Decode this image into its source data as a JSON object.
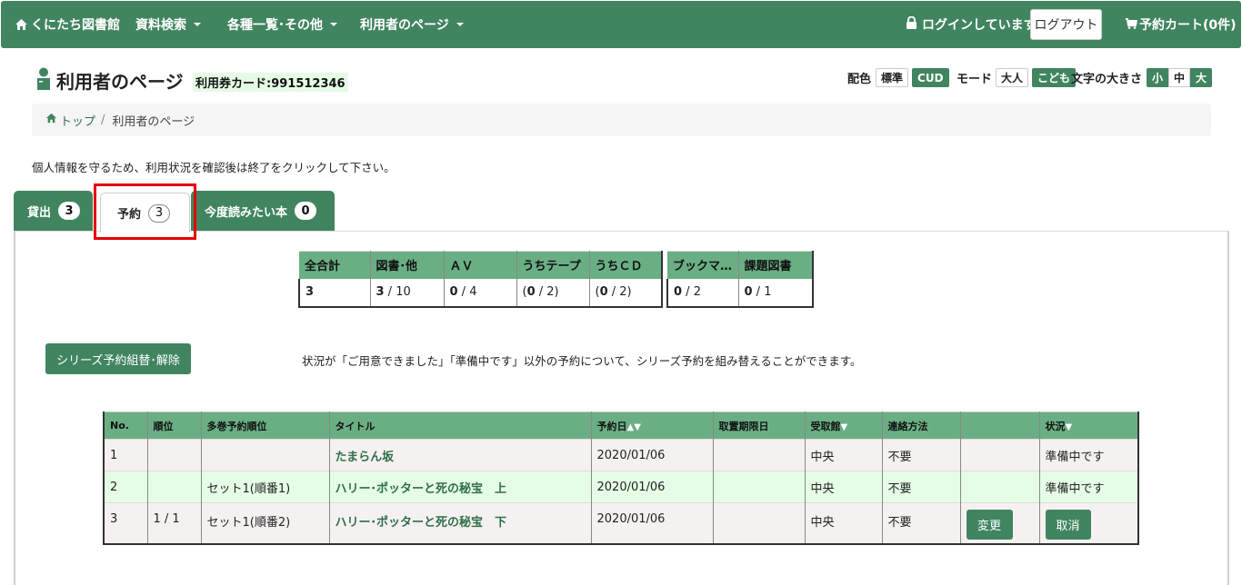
{
  "navbar": {
    "brand": "くにたち図書館",
    "menus": [
      {
        "label": "資料検索"
      },
      {
        "label": "各種一覧･その他"
      },
      {
        "label": "利用者のページ"
      }
    ],
    "login_status": "ログインしています",
    "logout_label": "ログアウト",
    "cart_label": "予約カート(0件)"
  },
  "header": {
    "title": "利用者のページ",
    "card_label": "利用券カード:991512346"
  },
  "preferences": {
    "color_label": "配色",
    "color_options": [
      "標準",
      "CUD"
    ],
    "color_selected": "CUD",
    "mode_label": "モード",
    "mode_options": [
      "大人",
      "こども"
    ],
    "mode_selected": "こども",
    "size_label": "文字の大きさ",
    "size_options": [
      "小",
      "中",
      "大"
    ],
    "size_selected": "中"
  },
  "breadcrumb": {
    "home": "トップ",
    "separator": "/",
    "current": "利用者のページ"
  },
  "notice": "個人情報を守るため、利用状況を確認後は終了をクリックして下さい。",
  "tabs": [
    {
      "label": "貸出",
      "count": "3",
      "active": false
    },
    {
      "label": "予約",
      "count": "3",
      "active": true
    },
    {
      "label": "今度読みたい本",
      "count": "0",
      "active": false
    }
  ],
  "summary": {
    "table1": {
      "headers": [
        "全合計",
        "図書･他",
        "ＡＶ",
        "うちテープ",
        "うちＣＤ"
      ],
      "cells": [
        {
          "bold": "3",
          "rest": "",
          "pre": ""
        },
        {
          "bold": "3",
          "rest": " / 10",
          "pre": ""
        },
        {
          "bold": "0",
          "rest": " / 4",
          "pre": ""
        },
        {
          "bold": "0",
          "rest": " / 2)",
          "pre": "("
        },
        {
          "bold": "0",
          "rest": " / 2)",
          "pre": "("
        }
      ]
    },
    "table2": {
      "headers": [
        "ブックマ…",
        "課題図書"
      ],
      "cells": [
        {
          "bold": "0",
          "rest": " / 2",
          "pre": ""
        },
        {
          "bold": "0",
          "rest": " / 1",
          "pre": ""
        }
      ]
    }
  },
  "series": {
    "button_label": "シリーズ予約組替･解除",
    "note": "状況が「ご用意できました」「準備中です」以外の予約について、シリーズ予約を組み替えることができます。"
  },
  "reservations": {
    "headers": {
      "no": "No.",
      "rank": "順位",
      "multi": "多巻予約順位",
      "title": "タイトル",
      "date": "予約日",
      "date_sort": "▲▼",
      "hold": "取置期限日",
      "branch": "受取館",
      "branch_sort": "▼",
      "contact": "連絡方法",
      "action": "",
      "status": "状況",
      "status_sort": "▼"
    },
    "rows": [
      {
        "no": "1",
        "rank": "",
        "multi": "",
        "title": "たまらん坂",
        "date": "2020/01/06",
        "hold": "",
        "branch": "中央",
        "contact": "不要",
        "change": "",
        "status": "準備中です",
        "cancel": ""
      },
      {
        "no": "2",
        "rank": "",
        "multi": "セット1(順番1)",
        "title": "ハリー･ポッターと死の秘宝　上",
        "date": "2020/01/06",
        "hold": "",
        "branch": "中央",
        "contact": "不要",
        "change": "",
        "status": "準備中です",
        "cancel": ""
      },
      {
        "no": "3",
        "rank": "1 / 1",
        "multi": "セット1(順番2)",
        "title": "ハリー･ポッターと死の秘宝　下",
        "date": "2020/01/06",
        "hold": "",
        "branch": "中央",
        "contact": "不要",
        "change": "変更",
        "status": "",
        "cancel": "取消"
      }
    ]
  },
  "colors": {
    "primary": "#418560",
    "table_header": "#6aaf84",
    "row_alt": "#e5fde5",
    "row_base": "#f5f1f0",
    "highlight": "#e30000"
  }
}
